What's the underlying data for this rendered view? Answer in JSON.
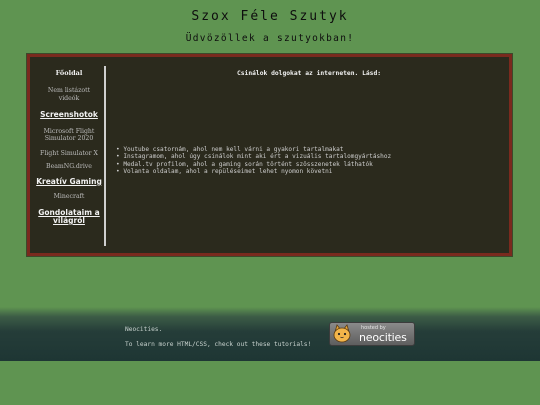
{
  "header": {
    "title": "Szox Féle Szutyk",
    "subtitle": "Üdvözöllek a szutyokban!"
  },
  "sidebar": {
    "heading": "Főoldal",
    "items": [
      {
        "label": "Nem listázott videók",
        "style": "plain"
      },
      {
        "label": "Screenshotok",
        "style": "bold"
      },
      {
        "label": "Microsoft Flight Simulator 2020",
        "style": "plain"
      },
      {
        "label": "Flight Simulator X",
        "style": "plain"
      },
      {
        "label": "BeamNG.drive",
        "style": "plain"
      },
      {
        "label": "Kreatív Gaming",
        "style": "bold"
      },
      {
        "label": "Minecraft",
        "style": "plain"
      },
      {
        "label": "Gondolataim a világról",
        "style": "bold"
      }
    ]
  },
  "main": {
    "intro": "Csinálok dolgokat az interneten. Lásd:",
    "links": [
      "Youtube csatornám, ahol nem kell várni a gyakori tartalmakat",
      "Instagramom, ahol úgy csinálok mint aki ért a vizuális tartalomgyártáshoz",
      "Medal.tv profilom, ahol a gaming során történt szösszenetek láthatók",
      "Volanta oldalam, ahol a repüléseimet lehet nyomon követni"
    ]
  },
  "footer": {
    "line1": "Neocities.",
    "line2": "To learn more HTML/CSS, check out these tutorials!",
    "badge_hosted": "hosted by",
    "badge_name": "neocities"
  },
  "colors": {
    "background": "#5f9451",
    "panel": "#2b2a1d",
    "panel_border": "#7a2a1e"
  }
}
